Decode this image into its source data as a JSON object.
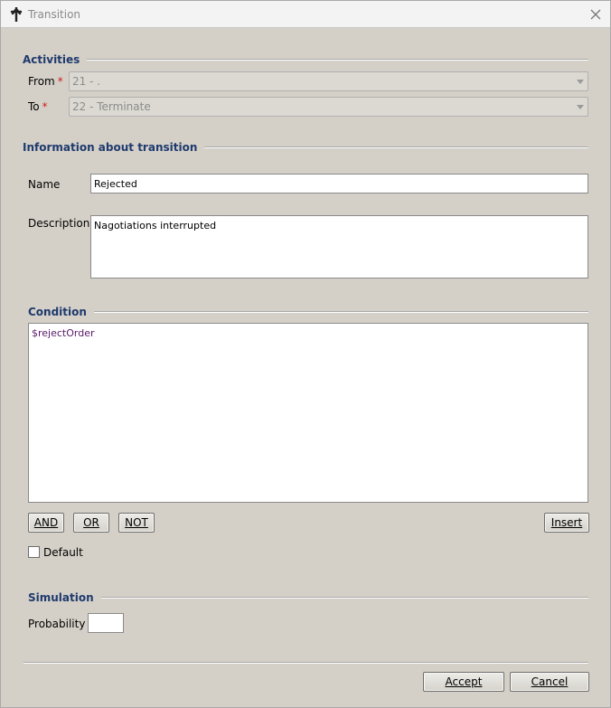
{
  "window": {
    "title": "Transition"
  },
  "activities": {
    "header": "Activities",
    "from_label": "From",
    "from_value": "21 - .",
    "to_label": "To",
    "to_value": "22 - Terminate",
    "required_mark": "*"
  },
  "info": {
    "header": "Information about transition",
    "name_label": "Name",
    "name_value": "Rejected",
    "description_label": "Description",
    "description_value": "Nagotiations interrupted"
  },
  "condition": {
    "header": "Condition",
    "expression": "$rejectOrder",
    "and_label": "AND",
    "or_label": "OR",
    "not_label": "NOT",
    "insert_label": "Insert",
    "default_label": "Default",
    "default_checked": false
  },
  "simulation": {
    "header": "Simulation",
    "probability_label": "Probability",
    "probability_value": ""
  },
  "footer": {
    "accept_label": "Accept",
    "cancel_label": "Cancel"
  }
}
